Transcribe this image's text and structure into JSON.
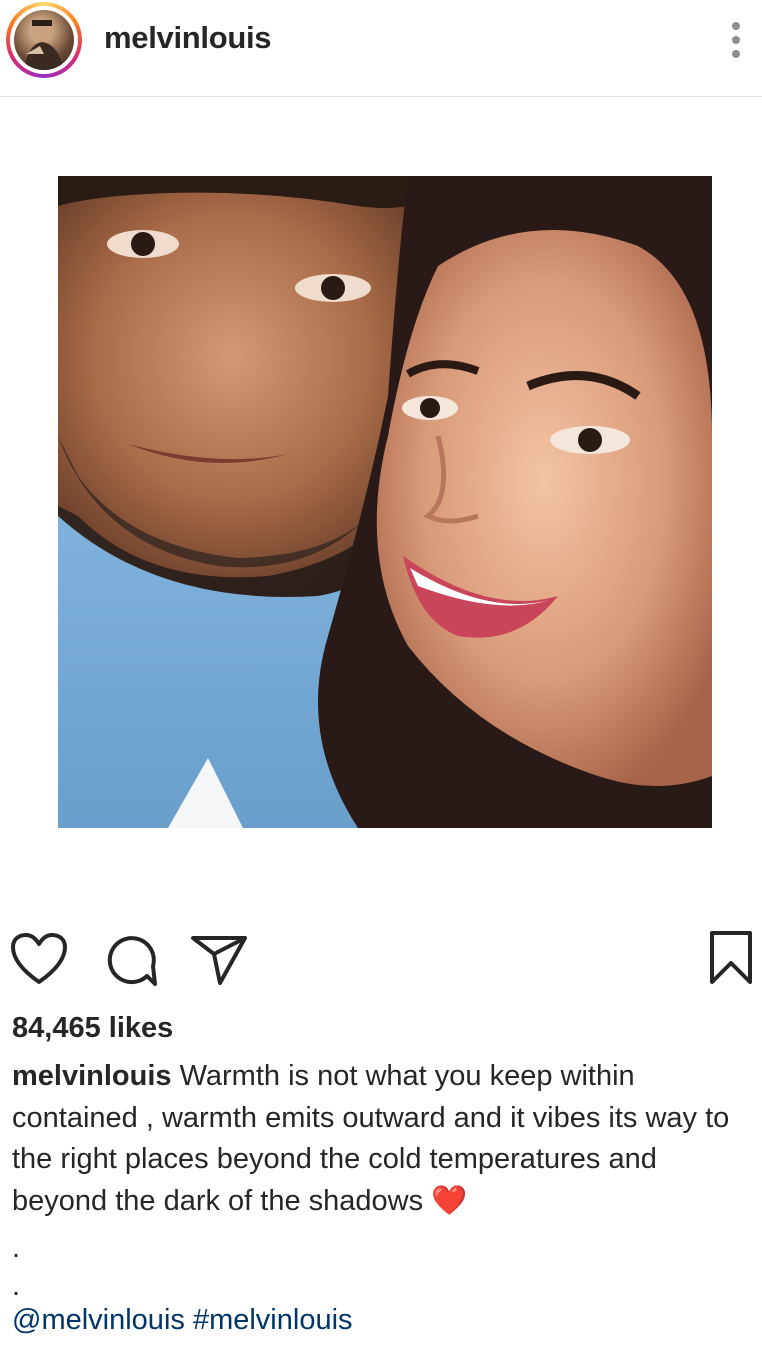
{
  "header": {
    "username": "melvinlouis",
    "avatar_icon": "profile-avatar",
    "more_icon": "more-options-icon"
  },
  "post": {
    "image_description_icon": "post-photo"
  },
  "actions": {
    "like_icon": "heart-icon",
    "comment_icon": "comment-icon",
    "share_icon": "send-icon",
    "save_icon": "bookmark-icon"
  },
  "likes": "84,465 likes",
  "caption": {
    "username": "melvinlouis",
    "text": " Warmth is not what you keep within contained , warmth emits outward and it vibes its way to the right places beyond the cold temperatures and beyond the dark of the shadows ",
    "emoji": "❤️",
    "dot1": ".",
    "dot2": ".",
    "mention": "@melvinlouis",
    "hashtag": "#melvinlouis"
  },
  "colors": {
    "link": "#003569",
    "text": "#262626",
    "icon": "#262626"
  }
}
